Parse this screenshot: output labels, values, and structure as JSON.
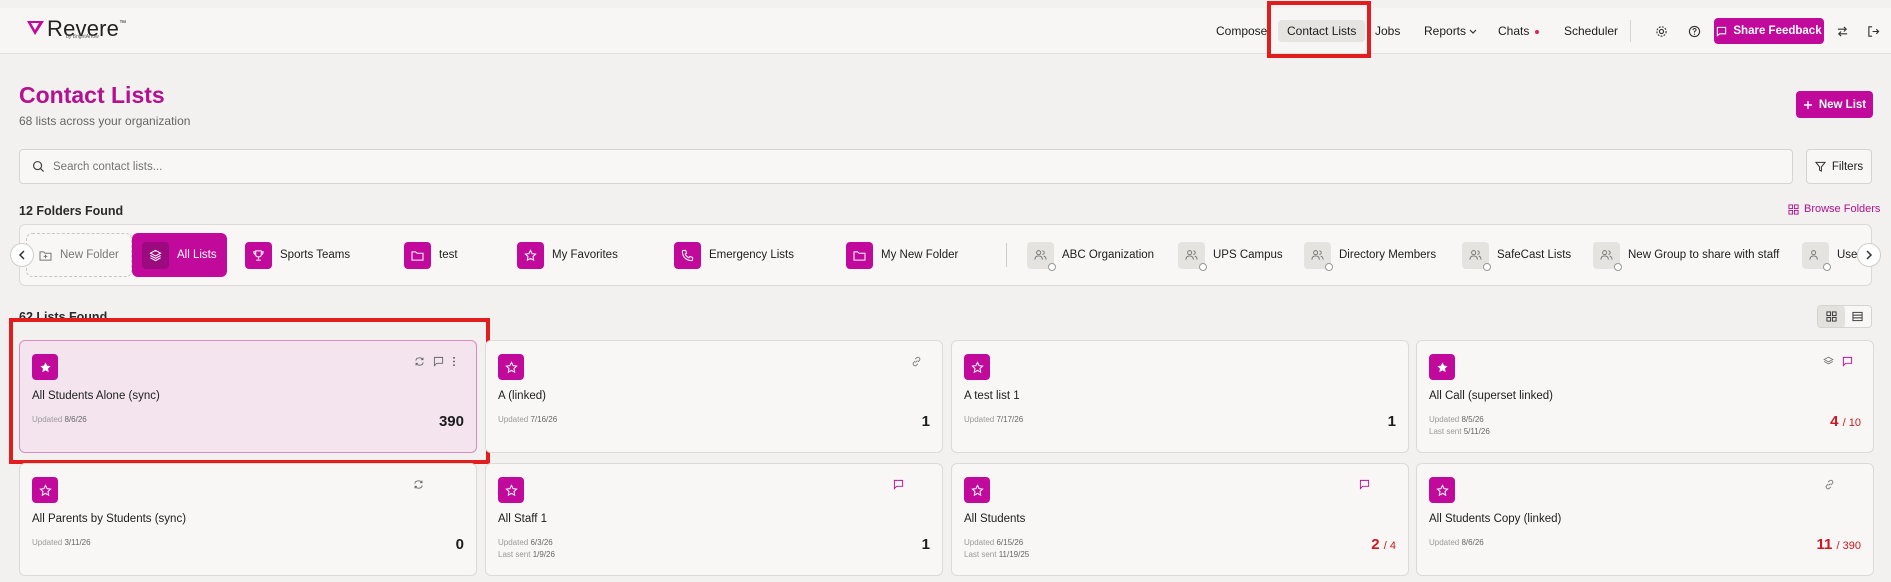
{
  "header": {
    "logo": "Revere",
    "logo_tm": "™",
    "logo_sub": "by BrightArrow",
    "nav": [
      "Compose",
      "Contact Lists",
      "Jobs",
      "Reports",
      "Chats",
      "Scheduler"
    ],
    "share_feedback": "Share Feedback"
  },
  "page": {
    "title": "Contact Lists",
    "subtitle": "68 lists across your organization",
    "new_list": "New List",
    "search_placeholder": "Search contact lists...",
    "filters": "Filters"
  },
  "folders": {
    "heading": "12 Folders Found",
    "browse": "Browse Folders",
    "new_folder": "New Folder",
    "all_lists": "All Lists",
    "items": [
      "Sports Teams",
      "test",
      "My Favorites",
      "Emergency Lists",
      "My New Folder"
    ],
    "groups": [
      "ABC Organization",
      "UPS Campus",
      "Directory Members",
      "SafeCast Lists",
      "New Group to share with staff",
      "Use"
    ]
  },
  "lists": {
    "heading": "62 Lists Found",
    "cards": [
      {
        "name": "All Students Alone (sync)",
        "updated_label": "Updated",
        "updated": "8/6/26",
        "count": "390"
      },
      {
        "name": "A (linked)",
        "updated_label": "Updated",
        "updated": "7/16/26",
        "count": "1"
      },
      {
        "name": "A test list 1",
        "updated_label": "Updated",
        "updated": "7/17/26",
        "count": "1"
      },
      {
        "name": "All Call (superset linked)",
        "updated_label": "Updated",
        "updated": "8/5/26",
        "sent_label": "Last sent",
        "sent": "5/11/26",
        "count": "4",
        "total": "/ 10"
      },
      {
        "name": "All Parents by Students (sync)",
        "updated_label": "Updated",
        "updated": "3/11/26",
        "count": "0"
      },
      {
        "name": "All Staff 1",
        "updated_label": "Updated",
        "updated": "6/3/26",
        "sent_label": "Last sent",
        "sent": "1/9/26",
        "count": "1"
      },
      {
        "name": "All Students",
        "updated_label": "Updated",
        "updated": "6/15/26",
        "sent_label": "Last sent",
        "sent": "11/19/25",
        "count": "2",
        "total": "/ 4"
      },
      {
        "name": "All Students Copy (linked)",
        "updated_label": "Updated",
        "updated": "8/6/26",
        "count": "11",
        "total": "/ 390"
      }
    ]
  },
  "colors": {
    "brand": "#c10a9c",
    "highlight": "#e11d1d",
    "alert": "#d0161e"
  }
}
